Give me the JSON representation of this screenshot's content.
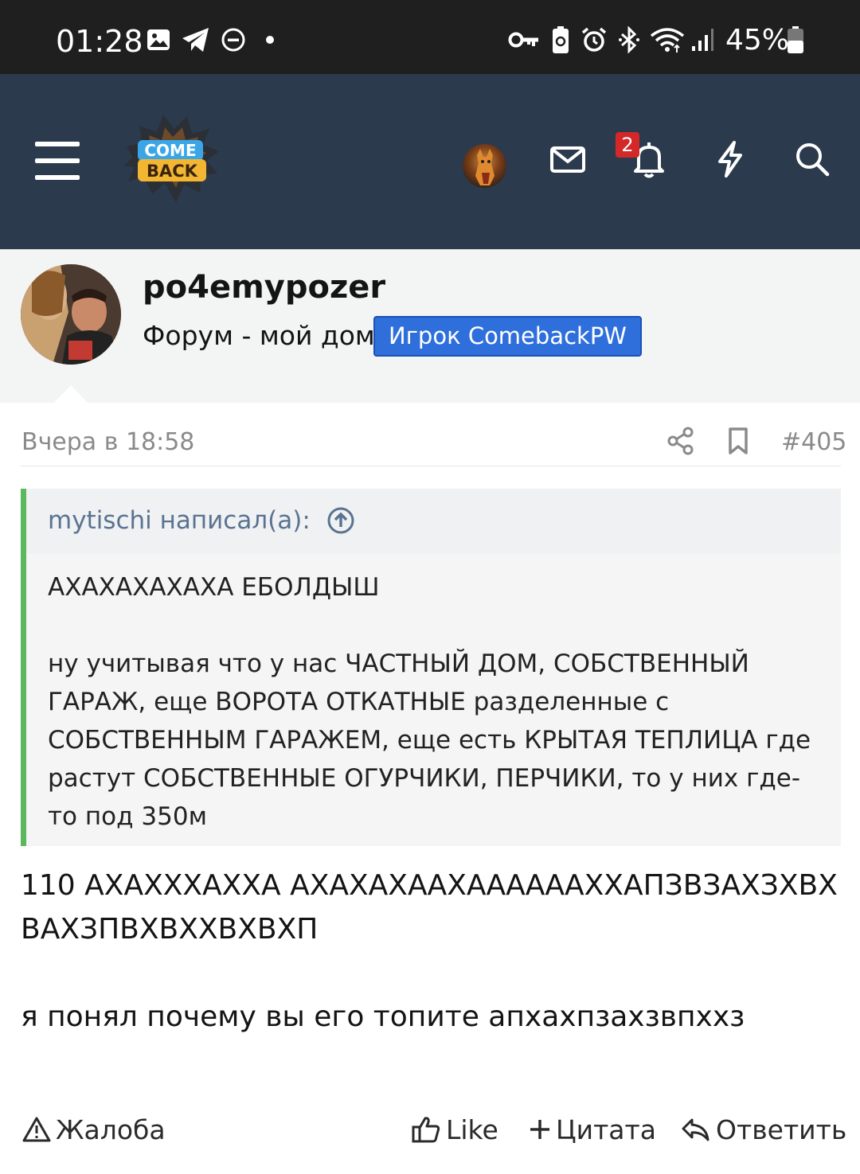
{
  "status_bar": {
    "time": "01:28",
    "battery": "45%",
    "icons": [
      "image-icon",
      "telegram-icon",
      "dnd-icon",
      "dot-icon",
      "key-icon",
      "battery-saver-icon",
      "alarm-icon",
      "bluetooth-icon",
      "wifi-icon",
      "signal-icon",
      "battery-icon"
    ]
  },
  "header": {
    "logo_alt": "COME BACK",
    "notifications_badge": "2",
    "icons": [
      "menu-icon",
      "mail-icon",
      "bell-icon",
      "lightning-icon",
      "search-icon"
    ]
  },
  "user": {
    "name": "po4emypozer",
    "title": "Форум - мой дом",
    "banner": "Игрок ComebackPW"
  },
  "post": {
    "date": "Вчера в 18:58",
    "number": "#405",
    "quote": {
      "author": "mytischi написал(а):",
      "lines": [
        "АХАХАХАХАХА ЕБОЛДЫШ",
        "ну учитывая что у нас ЧАСТНЫЙ ДОМ, СОБСТВЕННЫЙ ГАРАЖ, еще ВОРОТА ОТКАТНЫЕ разделенные с СОБСТВЕННЫМ ГАРАЖЕМ, еще есть КРЫТАЯ ТЕПЛИЦА где растут СОБСТВЕННЫЕ ОГУРЧИКИ, ПЕРЧИКИ, то у них где-то под 350м"
      ]
    },
    "body": [
      "110 АХАХХХАХХА АХАХАХААХААААААХХАПЗВЗАХЗХВХВАХЗПВХВХХВХВХП",
      "я понял почему вы его топите апхахпзахзвпххз"
    ],
    "actions": {
      "report": "Жалоба",
      "like": "Like",
      "quote": "Цитата",
      "reply": "Ответить"
    }
  },
  "colors": {
    "header_bg": "#2b3a4d",
    "banner_bg": "#2f6fdc",
    "quote_border": "#5cb85c",
    "badge_bg": "#d42828"
  }
}
